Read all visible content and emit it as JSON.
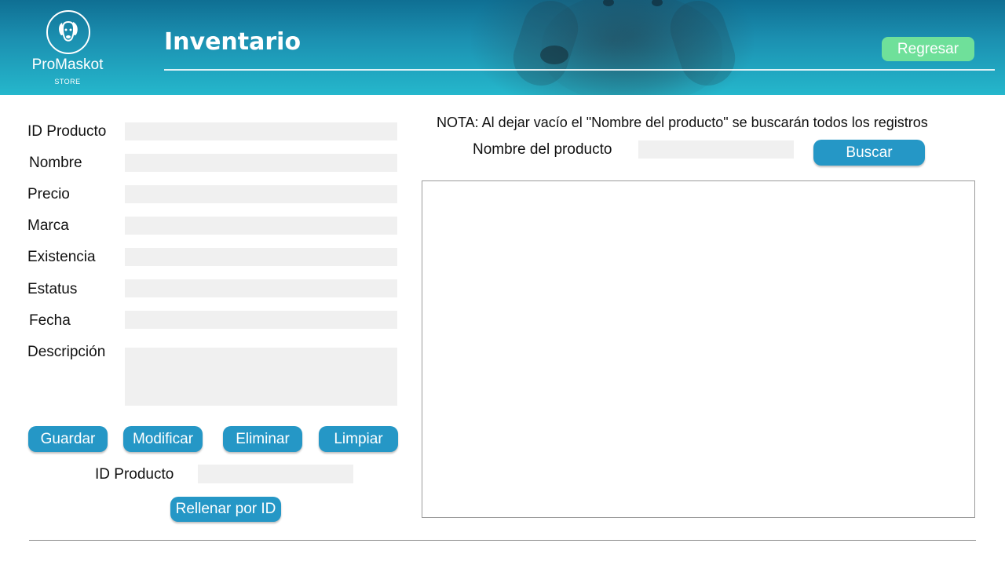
{
  "header": {
    "brand": "ProMaskot",
    "brand_sub": "STORE",
    "title": "Inventario",
    "back_button": "Regresar",
    "logo_icon": "dog-logo-icon",
    "colors": {
      "header_top": "#0f6f93",
      "header_bottom": "#25b7cc",
      "back_button_bg": "#6fe09a"
    }
  },
  "form": {
    "fields": [
      {
        "label": "ID Producto",
        "value": ""
      },
      {
        "label": "Nombre",
        "value": ""
      },
      {
        "label": "Precio",
        "value": ""
      },
      {
        "label": "Marca",
        "value": ""
      },
      {
        "label": "Existencia",
        "value": ""
      },
      {
        "label": "Estatus",
        "value": ""
      },
      {
        "label": "Fecha",
        "value": ""
      },
      {
        "label": "Descripción",
        "value": ""
      }
    ],
    "buttons": {
      "save": "Guardar",
      "modify": "Modificar",
      "delete": "Eliminar",
      "clear": "Limpiar"
    },
    "lookup": {
      "label": "ID Producto",
      "value": "",
      "button": "Rellenar por ID"
    }
  },
  "search": {
    "note": "NOTA: Al dejar vacío el \"Nombre del producto\" se buscarán todos los registros",
    "label": "Nombre del producto",
    "value": "",
    "button": "Buscar"
  },
  "results": {
    "rows": []
  },
  "colors": {
    "button_bg": "#2597c6",
    "field_bg": "#f0f0f0"
  }
}
